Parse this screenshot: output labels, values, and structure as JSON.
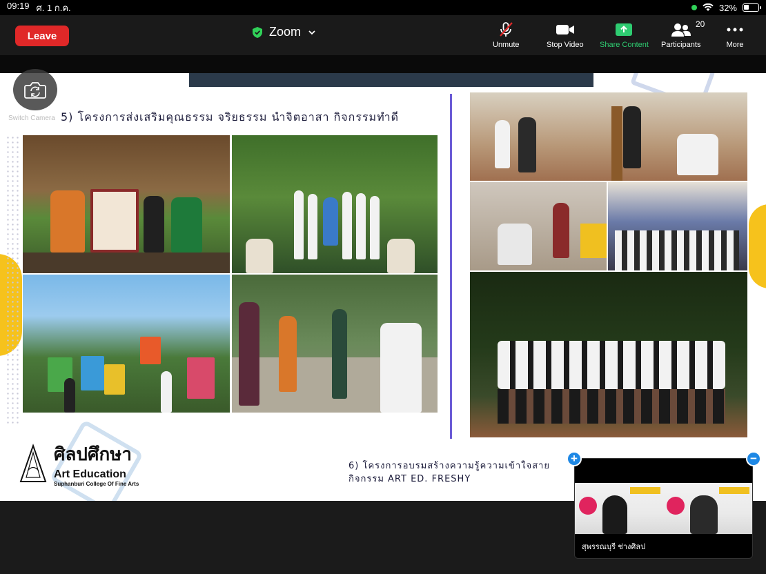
{
  "status_bar": {
    "time": "09:19",
    "date": "ศ. 1 ก.ค.",
    "battery": "32%",
    "icons": [
      "camera-in-use-indicator",
      "wifi-icon",
      "battery-icon"
    ]
  },
  "toolbar": {
    "leave_label": "Leave",
    "meeting_title": "Zoom",
    "unmute_label": "Unmute",
    "stop_video_label": "Stop Video",
    "share_label": "Share Content",
    "participants_label": "Participants",
    "participants_count": "20",
    "more_label": "More",
    "colors": {
      "leave": "#e02828",
      "share": "#2ecc71",
      "secure": "#30d158"
    }
  },
  "overlay": {
    "switch_camera_label": "Switch Camera"
  },
  "slide": {
    "heading_5": "5) โครงการส่งเสริมคุณธรรม จริยธรรม นำจิตอาสา กิจกรรมทำดี",
    "heading_6_line1": "6) โครงการอบรมสร้างความรู้ความเข้าใจสาย",
    "heading_6_line2": "กิจกรรม ART ED. FRESHY",
    "logo_thai": "ศิลปศึกษา",
    "logo_en": "Art Education",
    "logo_sub": "Suphanburi College Of Fine Arts",
    "colors": {
      "accent_yellow": "#f6c21c",
      "divider": "#6b5bd6",
      "text": "#1b1b3a"
    }
  },
  "thumbnail": {
    "participant_name": "สุพรรณบุรี ช่างศิลป",
    "plus_label": "+",
    "minus_label": "−"
  }
}
